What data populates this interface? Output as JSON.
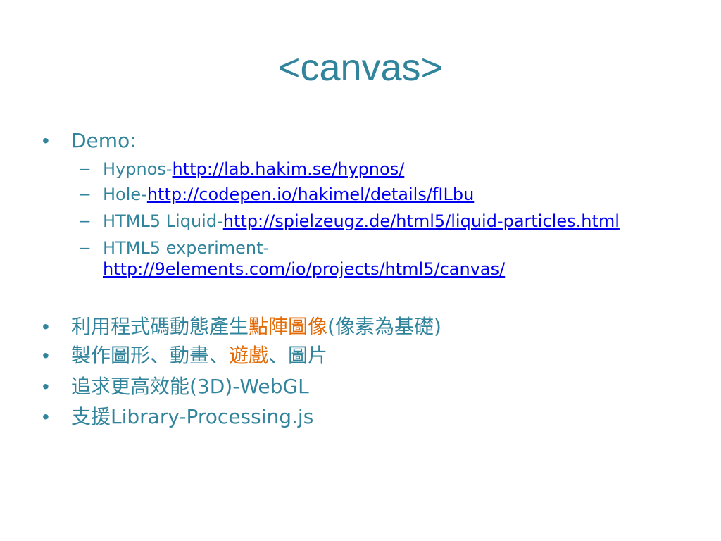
{
  "slide": {
    "title": "<canvas>",
    "demo": {
      "label": "Demo:",
      "items": [
        {
          "prefix": "Hypnos-",
          "link": "http://lab.hakim.se/hypnos/"
        },
        {
          "prefix": "Hole-",
          "link": "http://codepen.io/hakimel/details/fILbu"
        },
        {
          "prefix": "HTML5 Liquid-",
          "link": "http://spielzeugz.de/html5/liquid-particles.html"
        },
        {
          "prefix": "HTML5 experiment-",
          "link": "http://9elements.com/io/projects/html5/canvas/"
        }
      ]
    },
    "bullets": {
      "b1": {
        "part1": "利用程式碼動態產生",
        "highlight": "點陣圖像",
        "part2": "(像素為基礎)"
      },
      "b2": {
        "part1": "製作圖形、動畫、",
        "highlight": "遊戲",
        "part2": "、圖片"
      },
      "b3": {
        "text": "追求更高效能(3D)-WebGL"
      },
      "b4": {
        "text": "支援Library-Processing.js"
      }
    },
    "bullet_char": "•",
    "dash_char": "–",
    "colors": {
      "text": "#31849b",
      "link": "#0000ee",
      "highlight": "#e36c09"
    }
  }
}
